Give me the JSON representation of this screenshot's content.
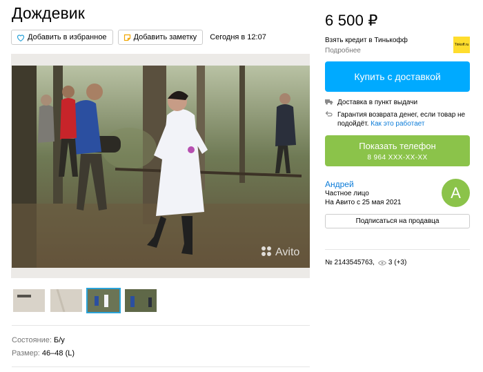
{
  "listing": {
    "title": "Дождевик",
    "favorite_label": "Добавить в избранное",
    "note_label": "Добавить заметку",
    "posted": "Сегодня в 12:07",
    "watermark": "Avito",
    "params": [
      {
        "key": "Состояние: ",
        "value": "Б/у"
      },
      {
        "key": "Размер: ",
        "value": "46–48 (L)"
      }
    ]
  },
  "sidebar": {
    "price": "6 500 ₽",
    "credit_title": "Взять кредит в Тинькофф",
    "credit_more": "Подробнее",
    "tinkoff_logo_text": "Tinkoff.ru",
    "buy_label": "Купить с доставкой",
    "delivery_text": "Доставка в пункт выдачи",
    "guarantee_text": "Гарантия возврата денег, если товар не подойдёт.",
    "guarantee_link": "Как это работает",
    "show_phone_label": "Показать телефон",
    "phone_masked": "8 964 XXX-XX-XX",
    "seller_name": "Андрей",
    "seller_type": "Частное лицо",
    "seller_since": "На Авито с 25 мая 2021",
    "avatar_letter": "А",
    "subscribe_label": "Подписаться на продавца",
    "listing_id": "№ 2143545763,",
    "views": "3 (+3)"
  },
  "colors": {
    "accent_blue": "#00aaff",
    "accent_green": "#8bc34a",
    "link": "#0a7bd8",
    "thumb_selected": "#2aa3d9"
  }
}
